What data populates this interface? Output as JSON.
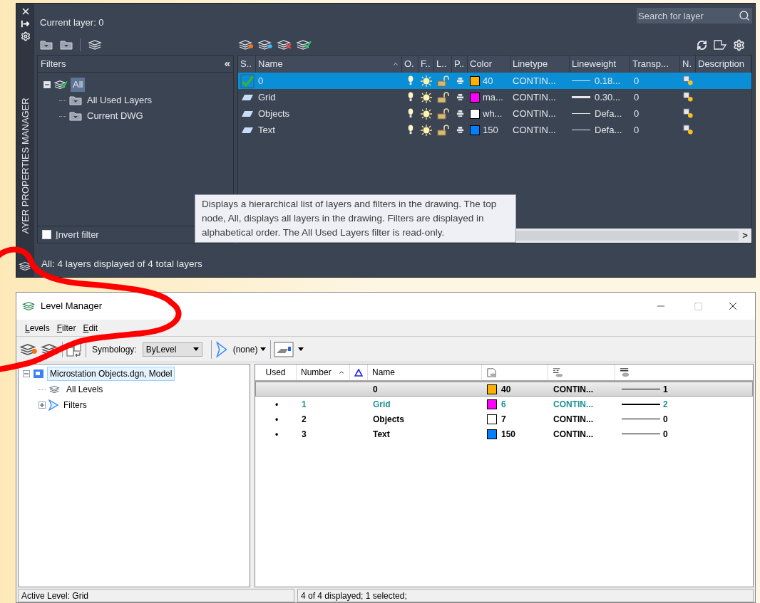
{
  "layer_palette": {
    "side_title": "AYER PROPERTIES MANAGER",
    "current_layer": "Current layer: 0",
    "search": {
      "placeholder": "Search for layer"
    },
    "filters": {
      "title": "Filters",
      "collapse_glyph": "«",
      "tree": [
        {
          "label": "All",
          "selected": true,
          "expanded": true,
          "children": [
            {
              "label": "All Used Layers",
              "selected": false
            },
            {
              "label": "Current DWG",
              "selected": false
            }
          ]
        }
      ],
      "invert_filter": {
        "label": "Invert filter",
        "checked": false
      }
    },
    "table": {
      "columns": [
        "S..",
        "Name",
        "O.",
        "F..",
        "L..",
        "P..",
        "Color",
        "Linetype",
        "Lineweight",
        "Transp...",
        "N.",
        "Description"
      ],
      "rows": [
        {
          "current": true,
          "selected": true,
          "name": "0",
          "color": "#ffb000",
          "color_label": "40",
          "linetype": "CONTIN...",
          "heavy": false,
          "lineweight": "0.18...",
          "transparency": "0"
        },
        {
          "current": false,
          "selected": false,
          "name": "Grid",
          "color": "#ff00ff",
          "color_label": "ma...",
          "linetype": "CONTIN...",
          "heavy": true,
          "lineweight": "0.30...",
          "transparency": "0"
        },
        {
          "current": false,
          "selected": false,
          "name": "Objects",
          "color": "#ffffff",
          "color_label": "wh...",
          "linetype": "CONTIN...",
          "heavy": false,
          "lineweight": "Defa...",
          "transparency": "0"
        },
        {
          "current": false,
          "selected": false,
          "name": "Text",
          "color": "#0080ff",
          "color_label": "150",
          "linetype": "CONTIN...",
          "heavy": false,
          "lineweight": "Defa...",
          "transparency": "0"
        }
      ]
    },
    "scroll_glyph": ">",
    "status": "All: 4 layers displayed of 4 total layers",
    "tooltip": "Displays a hierarchical list of layers and filters in the drawing. The top node, All, displays all layers in the drawing. Filters are displayed in alphabetical order. The All Used Layers filter is read-only."
  },
  "level_manager": {
    "title": "Level Manager",
    "menu": [
      "Levels",
      "Filter",
      "Edit"
    ],
    "symbology_label": "Symbology:",
    "symbology_value": "ByLevel",
    "filter_value": "(none)",
    "tree": [
      {
        "label": "Microstation Objects.dgn, Model",
        "selected": true,
        "expanded": true,
        "children": [
          {
            "label": "All Levels",
            "selected": false
          },
          {
            "label": "Filters",
            "selected": false,
            "expanded": false
          }
        ]
      }
    ],
    "columns": [
      "Used",
      "Number",
      "Name"
    ],
    "rows": [
      {
        "selected": true,
        "active": false,
        "name": "0",
        "color": "#ffb000",
        "color_label": "40",
        "linetype": "CONTIN...",
        "heavy": false,
        "lineweight": "1"
      },
      {
        "selected": false,
        "active": true,
        "used": "•",
        "number": "1",
        "name": "Grid",
        "color": "#ff00ff",
        "color_label": "6",
        "linetype": "CONTIN...",
        "heavy": true,
        "lineweight": "2"
      },
      {
        "selected": false,
        "active": false,
        "used": "•",
        "number": "2",
        "name": "Objects",
        "color": "#ffffff",
        "color_label": "7",
        "linetype": "CONTIN...",
        "heavy": false,
        "lineweight": "0"
      },
      {
        "selected": false,
        "active": false,
        "used": "•",
        "number": "3",
        "name": "Text",
        "color": "#0080ff",
        "color_label": "150",
        "linetype": "CONTIN...",
        "heavy": false,
        "lineweight": "0"
      }
    ],
    "status": [
      "Active Level: Grid",
      "4 of 4 displayed; 1 selected;"
    ]
  }
}
